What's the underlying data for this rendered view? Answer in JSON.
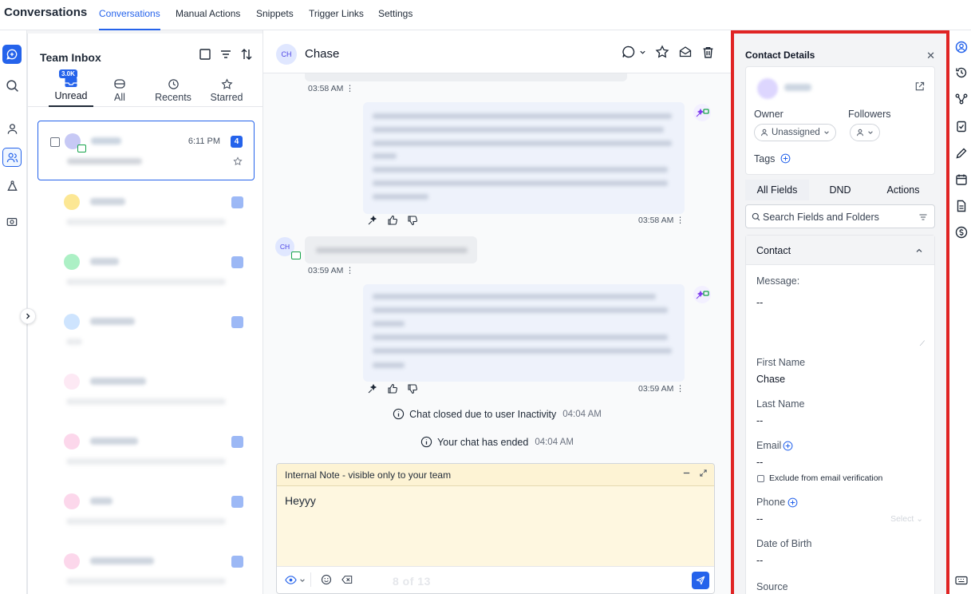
{
  "nav": {
    "brand": "Conversations",
    "tabs": [
      "Conversations",
      "Manual Actions",
      "Snippets",
      "Trigger Links",
      "Settings"
    ]
  },
  "inbox": {
    "title": "Team Inbox",
    "filters": [
      {
        "label": "Unread",
        "icon": "inbox-icon",
        "badge": "3.0K"
      },
      {
        "label": "All",
        "icon": "archive-icon"
      },
      {
        "label": "Recents",
        "icon": "clock-icon"
      },
      {
        "label": "Starred",
        "icon": "star-icon"
      }
    ],
    "selected_item": {
      "time": "6:11 PM",
      "unread_count": "4"
    }
  },
  "chat": {
    "avatar_initials": "CH",
    "contact_name": "Chase",
    "timestamps": {
      "t1": "03:58 AM",
      "t2": "03:58 AM",
      "t3": "03:59 AM",
      "t4": "03:59 AM"
    },
    "incoming_avatar": "CH",
    "system": {
      "closed_text": "Chat closed due to user Inactivity",
      "closed_time": "04:04 AM",
      "ended_text": "Your chat has ended",
      "ended_time": "04:04 AM"
    },
    "composer": {
      "title": "Internal Note - visible only to your team",
      "text": "Heyyy",
      "page_indicator": "8 of 13"
    }
  },
  "details": {
    "title": "Contact Details",
    "owner_label": "Owner",
    "owner_value": "Unassigned",
    "followers_label": "Followers",
    "tags_label": "Tags",
    "segments": [
      "All Fields",
      "DND",
      "Actions"
    ],
    "search_placeholder": "Search Fields and Folders",
    "section": "Contact",
    "fields": {
      "message_label": "Message:",
      "message_value": "--",
      "first_name_label": "First Name",
      "first_name_value": "Chase",
      "last_name_label": "Last Name",
      "last_name_value": "--",
      "email_label": "Email",
      "email_value": "--",
      "exclude_label": "Exclude from email verification",
      "phone_label": "Phone",
      "phone_value": "--",
      "phone_select": "Select",
      "dob_label": "Date of Birth",
      "dob_value": "--",
      "source_label": "Source"
    }
  },
  "colors": {
    "accent": "#2563eb",
    "highlight_border": "#e02424",
    "composer_bg": "#fef7e0",
    "channel_green": "#16a34a"
  }
}
